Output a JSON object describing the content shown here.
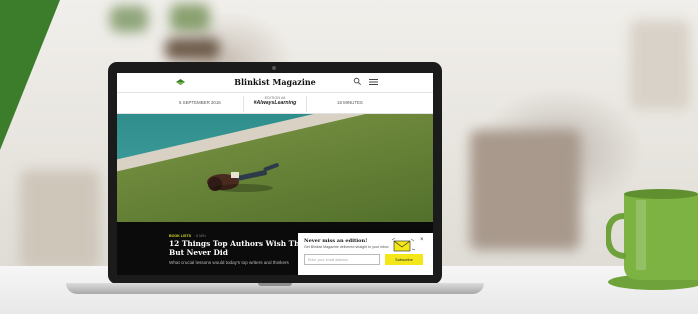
{
  "site": {
    "title": "Blinkist Magazine",
    "date": "5 SEPTEMBER 2016",
    "edition_label": "EDITION #8",
    "edition_tag": "#AlwaysLearning",
    "read_time": "18 MINUTES"
  },
  "article": {
    "kicker": "BOOK LISTS",
    "kicker_sub": "· 8 MIN",
    "headline_line1": "12 Things Top Authors Wish They",
    "headline_line2": "But Never Did",
    "deck": "What crucial lessons would today's top writers and thinkers"
  },
  "popup": {
    "title": "Never miss an edition!",
    "description": "Get Blinkist Magazine delivered straight to your inbox",
    "email_placeholder": "Enter your email address",
    "subscribe_label": "Subscribe",
    "close_label": "×"
  },
  "colors": {
    "brand_green": "#3b7d2b",
    "accent_yellow": "#f3e71a",
    "article_band": "#0b0b0b"
  },
  "icons": [
    "blinkist-logo-icon",
    "search-icon",
    "menu-icon",
    "close-icon",
    "mail-illustration-icon"
  ]
}
